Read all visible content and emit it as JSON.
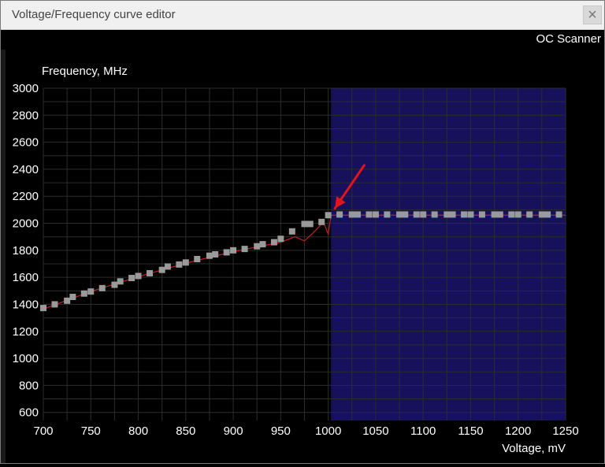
{
  "window": {
    "title": "Voltage/Frequency curve editor",
    "close_glyph": "×"
  },
  "toolbar": {
    "oc_scanner_label": "OC Scanner"
  },
  "chart_data": {
    "type": "scatter",
    "ylabel": "Frequency, MHz",
    "xlabel": "Voltage, mV",
    "xlim": [
      700,
      1250
    ],
    "ylim": [
      500,
      3000
    ],
    "x_ticks": [
      700,
      750,
      800,
      850,
      900,
      950,
      1000,
      1050,
      1100,
      1150,
      1200,
      1250
    ],
    "y_ticks": [
      600,
      800,
      1000,
      1200,
      1400,
      1600,
      1800,
      2000,
      2200,
      2400,
      2600,
      2800,
      3000
    ],
    "grid": true,
    "highlight_region": {
      "x_start": 1003,
      "x_end": 1250,
      "color": "#16115a"
    },
    "point_color": "#9a9a9a",
    "line_color": "#c0202a",
    "arrow_color": "#e0141c",
    "points": [
      {
        "x": 700,
        "y": 1373
      },
      {
        "x": 712,
        "y": 1400
      },
      {
        "x": 725,
        "y": 1427
      },
      {
        "x": 731,
        "y": 1455
      },
      {
        "x": 743,
        "y": 1480
      },
      {
        "x": 750,
        "y": 1495
      },
      {
        "x": 762,
        "y": 1520
      },
      {
        "x": 775,
        "y": 1545
      },
      {
        "x": 781,
        "y": 1570
      },
      {
        "x": 793,
        "y": 1595
      },
      {
        "x": 800,
        "y": 1610
      },
      {
        "x": 812,
        "y": 1630
      },
      {
        "x": 825,
        "y": 1655
      },
      {
        "x": 831,
        "y": 1680
      },
      {
        "x": 843,
        "y": 1695
      },
      {
        "x": 850,
        "y": 1710
      },
      {
        "x": 862,
        "y": 1735
      },
      {
        "x": 875,
        "y": 1760
      },
      {
        "x": 881,
        "y": 1770
      },
      {
        "x": 893,
        "y": 1785
      },
      {
        "x": 900,
        "y": 1800
      },
      {
        "x": 912,
        "y": 1810
      },
      {
        "x": 925,
        "y": 1830
      },
      {
        "x": 931,
        "y": 1845
      },
      {
        "x": 943,
        "y": 1860
      },
      {
        "x": 950,
        "y": 1885
      },
      {
        "x": 962,
        "y": 1940
      },
      {
        "x": 975,
        "y": 1995
      },
      {
        "x": 981,
        "y": 1995
      },
      {
        "x": 993,
        "y": 2010
      },
      {
        "x": 1000,
        "y": 2060
      },
      {
        "x": 1012,
        "y": 2065
      },
      {
        "x": 1025,
        "y": 2065
      },
      {
        "x": 1031,
        "y": 2065
      },
      {
        "x": 1043,
        "y": 2065
      },
      {
        "x": 1050,
        "y": 2065
      },
      {
        "x": 1062,
        "y": 2065
      },
      {
        "x": 1075,
        "y": 2065
      },
      {
        "x": 1081,
        "y": 2065
      },
      {
        "x": 1093,
        "y": 2065
      },
      {
        "x": 1100,
        "y": 2065
      },
      {
        "x": 1112,
        "y": 2065
      },
      {
        "x": 1125,
        "y": 2065
      },
      {
        "x": 1131,
        "y": 2065
      },
      {
        "x": 1143,
        "y": 2065
      },
      {
        "x": 1150,
        "y": 2065
      },
      {
        "x": 1162,
        "y": 2065
      },
      {
        "x": 1175,
        "y": 2065
      },
      {
        "x": 1181,
        "y": 2065
      },
      {
        "x": 1193,
        "y": 2065
      },
      {
        "x": 1200,
        "y": 2065
      },
      {
        "x": 1212,
        "y": 2065
      },
      {
        "x": 1225,
        "y": 2065
      },
      {
        "x": 1231,
        "y": 2065
      },
      {
        "x": 1243,
        "y": 2065
      }
    ],
    "curve": [
      {
        "x": 700,
        "y": 1365
      },
      {
        "x": 750,
        "y": 1495
      },
      {
        "x": 800,
        "y": 1605
      },
      {
        "x": 850,
        "y": 1705
      },
      {
        "x": 900,
        "y": 1790
      },
      {
        "x": 950,
        "y": 1860
      },
      {
        "x": 965,
        "y": 1900
      },
      {
        "x": 975,
        "y": 1870
      },
      {
        "x": 985,
        "y": 1935
      },
      {
        "x": 995,
        "y": 2010
      },
      {
        "x": 1000,
        "y": 1920
      },
      {
        "x": 1003,
        "y": 2060
      },
      {
        "x": 1250,
        "y": 2060
      }
    ],
    "arrow": {
      "from": {
        "x": 1038,
        "y": 2430
      },
      "to": {
        "x": 1007,
        "y": 2110
      }
    }
  }
}
